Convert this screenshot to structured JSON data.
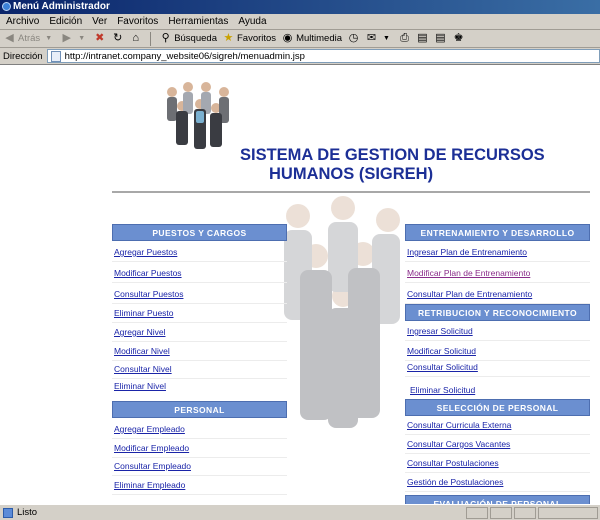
{
  "window": {
    "title": "Menú Administrador"
  },
  "menubar": [
    "Archivo",
    "Edición",
    "Ver",
    "Favoritos",
    "Herramientas",
    "Ayuda"
  ],
  "toolbar": {
    "back": "Atrás",
    "search": "Búsqueda",
    "favorites": "Favoritos",
    "multimedia": "Multimedia"
  },
  "address": {
    "label": "Dirección",
    "url": "http://intranet.company_website06/sigreh/menuadmin.jsp"
  },
  "page": {
    "title_line1": "SISTEMA DE GESTION DE RECURSOS",
    "title_line2": "HUMANOS (SIGREH)",
    "sections": {
      "puestos": {
        "title": "PUESTOS Y CARGOS",
        "links": [
          "Agregar Puestos",
          "Modificar Puestos",
          "Consultar Puestos",
          "Eliminar Puesto",
          "Agregar Nivel",
          "Modificar Nivel",
          "Consultar Nivel",
          "Eliminar Nivel"
        ]
      },
      "personal": {
        "title": "PERSONAL",
        "links": [
          "Agregar Empleado",
          "Modificar Empleado",
          "Consultar Empleado",
          "Eliminar Empleado"
        ]
      },
      "entrenamiento": {
        "title": "ENTRENAMIENTO Y DESARROLLO",
        "links": [
          "Ingresar Plan de Entrenamiento",
          "Modificar Plan de Entrenamiento",
          "Consultar Plan de Entrenamiento"
        ]
      },
      "retribucion": {
        "title": "RETRIBUCION Y RECONOCIMIENTO",
        "links": [
          "Ingresar Solicitud",
          "Modificar Solicitud",
          "Consultar Solicitud",
          "Eliminar Solicitud"
        ]
      },
      "seleccion": {
        "title": "SELECCIÓN DE PERSONAL",
        "links": [
          "Consultar Curricula Externa",
          "Consultar Cargos Vacantes",
          "Consultar Postulaciones",
          "Gestión de Postulaciones"
        ]
      },
      "evaluacion": {
        "title": "EVALUACIÓN DE PERSONAL"
      }
    }
  },
  "status": {
    "text": "Listo"
  },
  "colors": {
    "section_header": "#6b8fd0",
    "heading": "#1c2f96",
    "link": "#1a24a8",
    "visited_link": "#8a2b8a"
  }
}
